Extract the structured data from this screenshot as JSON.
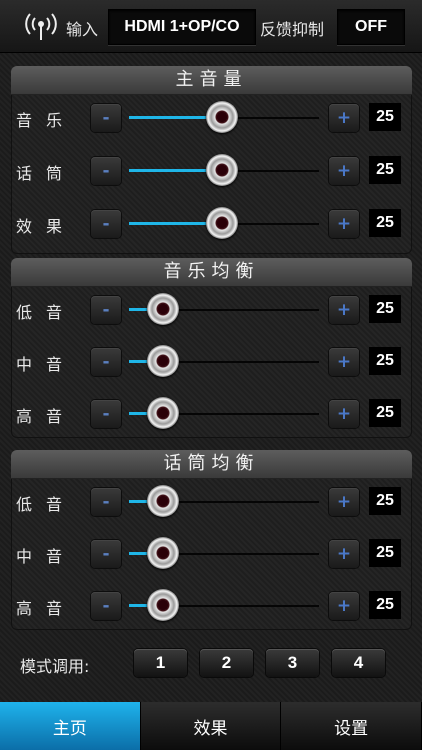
{
  "header": {
    "input_label": "输入",
    "input_value": "HDMI 1+OP/CO",
    "feedback_label": "反馈抑制",
    "feedback_value": "OFF"
  },
  "panels": [
    {
      "title": "主音量",
      "rows": [
        {
          "label": "音乐",
          "value": "25",
          "level": 0.49
        },
        {
          "label": "话筒",
          "value": "25",
          "level": 0.49
        },
        {
          "label": "效果",
          "value": "25",
          "level": 0.49
        }
      ]
    },
    {
      "title": "音乐均衡",
      "rows": [
        {
          "label": "低音",
          "value": "25",
          "level": 0.18
        },
        {
          "label": "中音",
          "value": "25",
          "level": 0.18
        },
        {
          "label": "高音",
          "value": "25",
          "level": 0.18
        }
      ]
    },
    {
      "title": "话筒均衡",
      "rows": [
        {
          "label": "低音",
          "value": "25",
          "level": 0.18
        },
        {
          "label": "中音",
          "value": "25",
          "level": 0.18
        },
        {
          "label": "高音",
          "value": "25",
          "level": 0.18
        }
      ]
    }
  ],
  "buttons": {
    "minus": "-",
    "plus": "+"
  },
  "modes": {
    "label": "模式调用:",
    "items": [
      "1",
      "2",
      "3",
      "4"
    ]
  },
  "tabs": [
    {
      "label": "主页",
      "active": true
    },
    {
      "label": "效果",
      "active": false
    },
    {
      "label": "设置",
      "active": false
    }
  ],
  "colors": {
    "accent": "#1fb6e8",
    "tab_active": "#1fb3ec"
  }
}
